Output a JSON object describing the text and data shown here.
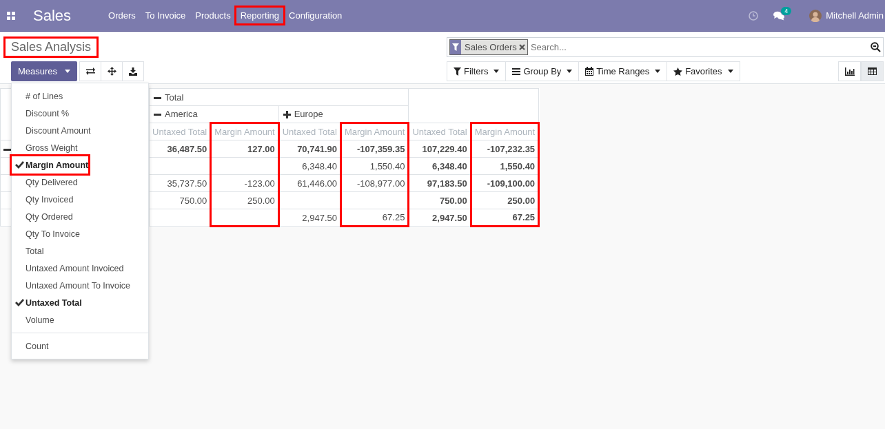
{
  "navbar": {
    "app": "Sales",
    "menu": [
      {
        "label": "Orders",
        "highlighted": false
      },
      {
        "label": "To Invoice",
        "highlighted": false
      },
      {
        "label": "Products",
        "highlighted": false
      },
      {
        "label": "Reporting",
        "highlighted": true
      },
      {
        "label": "Configuration",
        "highlighted": false
      }
    ],
    "messages_badge": "4",
    "user": "Mitchell Admin"
  },
  "title": {
    "label": "Sales Analysis",
    "highlighted": true
  },
  "measures_button": "Measures",
  "search": {
    "facets": [
      {
        "label": "Sales Orders"
      }
    ],
    "placeholder": "Search..."
  },
  "search_options": [
    {
      "label": "Filters",
      "kind": "filter"
    },
    {
      "label": "Group By",
      "kind": "group"
    },
    {
      "label": "Time Ranges",
      "kind": "calendar"
    },
    {
      "label": "Favorites",
      "kind": "star"
    }
  ],
  "views": [
    {
      "kind": "graph",
      "selected": false
    },
    {
      "kind": "pivot",
      "selected": true
    }
  ],
  "measures_menu": [
    {
      "label": "# of Lines",
      "selected": false,
      "highlighted": false,
      "kind": "measure"
    },
    {
      "label": "Discount %",
      "selected": false,
      "highlighted": false,
      "kind": "measure"
    },
    {
      "label": "Discount Amount",
      "selected": false,
      "highlighted": false,
      "kind": "measure"
    },
    {
      "label": "Gross Weight",
      "selected": false,
      "highlighted": false,
      "kind": "measure"
    },
    {
      "label": "Margin Amount",
      "selected": true,
      "highlighted": true,
      "kind": "measure"
    },
    {
      "label": "Qty Delivered",
      "selected": false,
      "highlighted": false,
      "kind": "measure"
    },
    {
      "label": "Qty Invoiced",
      "selected": false,
      "highlighted": false,
      "kind": "measure"
    },
    {
      "label": "Qty Ordered",
      "selected": false,
      "highlighted": false,
      "kind": "measure"
    },
    {
      "label": "Qty To Invoice",
      "selected": false,
      "highlighted": false,
      "kind": "measure"
    },
    {
      "label": "Total",
      "selected": false,
      "highlighted": false,
      "kind": "measure"
    },
    {
      "label": "Untaxed Amount Invoiced",
      "selected": false,
      "highlighted": false,
      "kind": "measure"
    },
    {
      "label": "Untaxed Amount To Invoice",
      "selected": false,
      "highlighted": false,
      "kind": "measure"
    },
    {
      "label": "Untaxed Total",
      "selected": true,
      "highlighted": false,
      "kind": "measure"
    },
    {
      "label": "Volume",
      "selected": false,
      "highlighted": false,
      "kind": "measure"
    },
    {
      "label": "Count",
      "selected": false,
      "highlighted": false,
      "kind": "count"
    }
  ],
  "pivot": {
    "column_header": {
      "label": "Total",
      "expanded": true
    },
    "groups": [
      {
        "kind": "region",
        "label": "America",
        "expanded": true,
        "measures": [
          {
            "label": "Untaxed Total",
            "highlighted": false
          },
          {
            "label": "Margin Amount",
            "highlighted": true
          }
        ]
      },
      {
        "kind": "region",
        "label": "Europe",
        "expanded": false,
        "measures": [
          {
            "label": "Untaxed Total",
            "highlighted": false
          },
          {
            "label": "Margin Amount",
            "highlighted": true
          }
        ]
      },
      {
        "kind": "total",
        "measures": [
          {
            "label": "Untaxed Total",
            "highlighted": false
          },
          {
            "label": "Margin Amount",
            "highlighted": true
          }
        ]
      }
    ],
    "rows": [
      {
        "kind": "total",
        "expanded": true,
        "cells": [
          "36,487.50",
          "127.00",
          "70,741.90",
          "-107,359.35",
          "107,229.40",
          "-107,232.35"
        ]
      },
      {
        "kind": "group",
        "cells": [
          null,
          null,
          "6,348.40",
          "1,550.40",
          "6,348.40",
          "1,550.40"
        ]
      },
      {
        "kind": "group",
        "cells": [
          "35,737.50",
          "-123.00",
          "61,446.00",
          "-108,977.00",
          "97,183.50",
          "-109,100.00"
        ]
      },
      {
        "kind": "group",
        "cells": [
          "750.00",
          "250.00",
          null,
          null,
          "750.00",
          "250.00"
        ]
      },
      {
        "kind": "group",
        "cells": [
          null,
          null,
          "2,947.50",
          "67.25",
          "2,947.50",
          "67.25"
        ]
      }
    ]
  }
}
